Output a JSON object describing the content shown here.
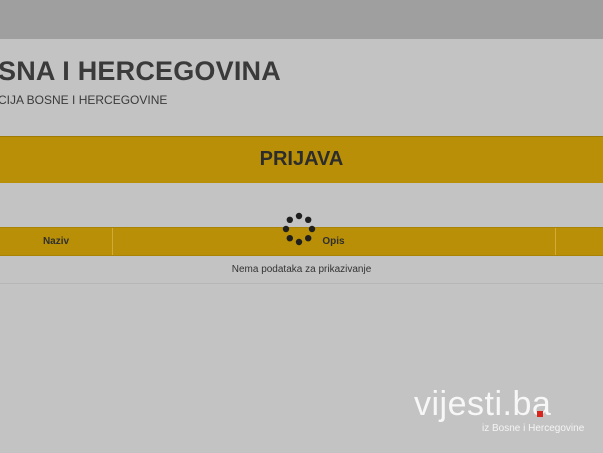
{
  "header": {
    "title": "SNA I HERCEGOVINA",
    "subtitle": "CIJA BOSNE I HERCEGOVINE"
  },
  "banner": {
    "label": "PRIJAVA"
  },
  "table": {
    "columns": [
      "Naziv",
      "Opis",
      ""
    ],
    "empty_message": "Nema podataka za prikazivanje"
  },
  "watermark": {
    "text": "vijesti.ba",
    "subtext": "iz Bosne i Hercegovine"
  },
  "colors": {
    "accent": "#b88f07",
    "background": "#c3c3c3",
    "topbar": "#9f9f9f",
    "watermark_dot": "#d9261c"
  }
}
